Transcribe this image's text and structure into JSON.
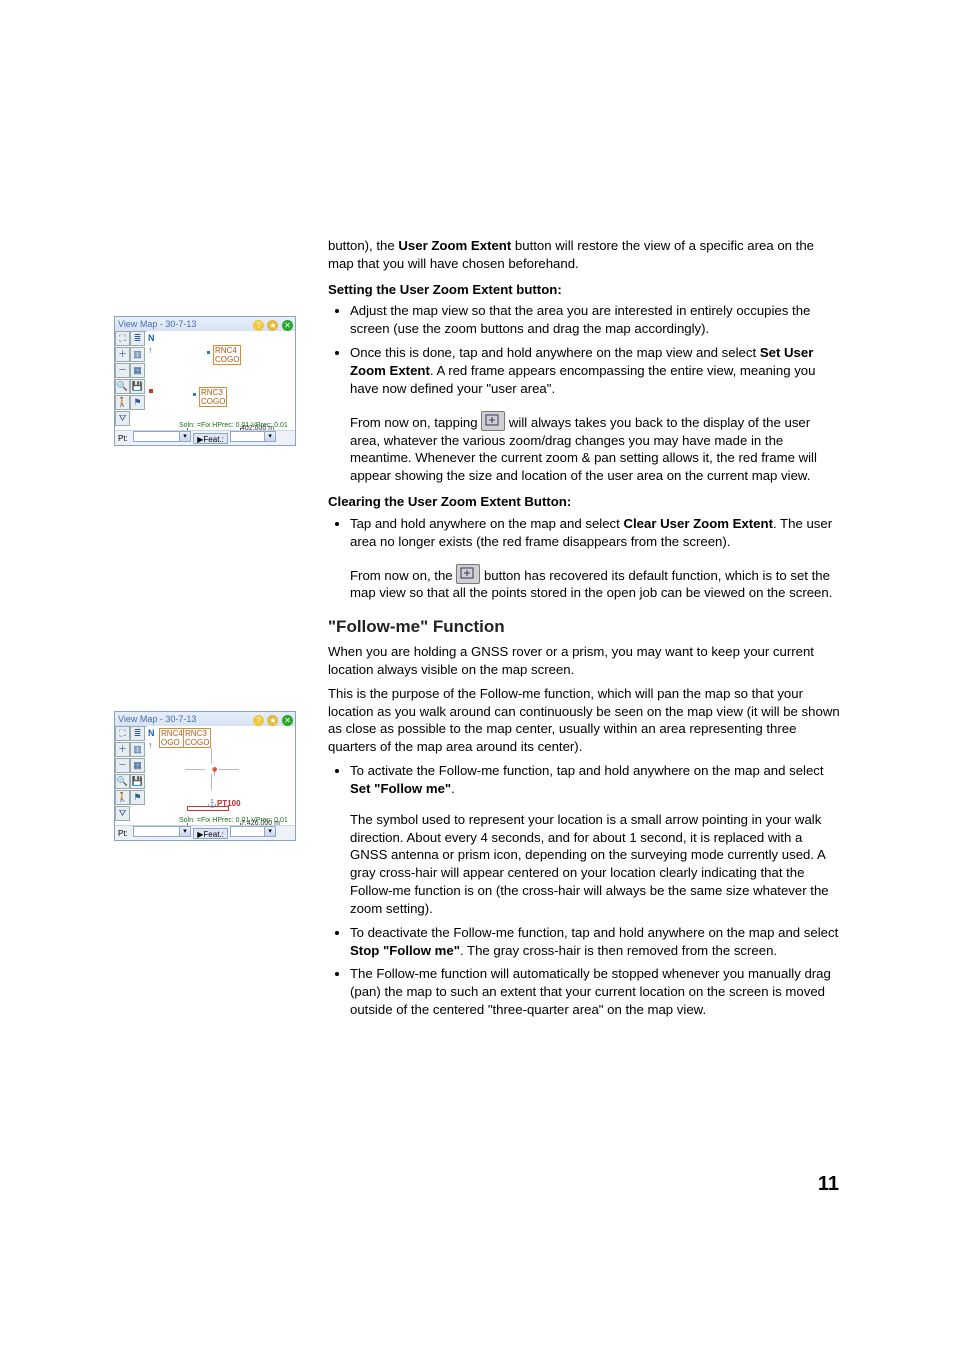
{
  "page_number": "11",
  "intro": {
    "p1_a": "button), the ",
    "p1_b": "User Zoom Extent",
    "p1_c": " button will restore the view of a specific area on the map that you will have chosen beforehand."
  },
  "setting": {
    "hdr": "Setting the User Zoom Extent button",
    "hdr_colon": ":",
    "b1": "Adjust the map view so that the area you are interested in entirely occupies the screen (use the zoom buttons and drag the map accordingly).",
    "b2_a": "Once this is done, tap and hold anywhere on the map view and select ",
    "b2_b": "Set User Zoom Extent",
    "b2_c": ". A red frame appears encompassing the entire view, meaning you have now defined your \"user area\".",
    "after1_a": "From now on, tapping ",
    "after1_b": " will always takes you back to the display of the user area, whatever the various zoom/drag changes you may have made in the meantime. Whenever the current zoom & pan setting allows it, the red frame will appear showing the size and location of the user area on the current map view."
  },
  "clearing": {
    "hdr": "Clearing the User Zoom Extent Button",
    "hdr_colon": ":",
    "b1_a": "Tap and hold anywhere on the map and select ",
    "b1_b": "Clear User Zoom Extent",
    "b1_c": ". The user area no longer exists (the red frame disappears from the screen).",
    "after1_a": "From now on, the ",
    "after1_b": " button has recovered its default function, which is to set the map view so that all the points stored in the open job can be viewed on the screen."
  },
  "follow": {
    "hdr": "\"Follow-me\" Function",
    "p1": "When you are holding a GNSS rover or a prism, you may want to keep your current location always visible on the map screen.",
    "p2": "This is the purpose of the Follow-me function, which will pan the map so that your location as you walk around can continuously be seen on the map view (it will be shown as close as possible to the map center, usually within an area representing three quarters of the map area around its center).",
    "b1_a": "To activate the Follow-me function, tap and hold anywhere on the map and select ",
    "b1_b": "Set \"Follow me\"",
    "b1_c": ".",
    "after1": "The symbol used to represent your location is a small arrow pointing in your walk direction. About every 4 seconds, and for about 1 second, it is replaced with a GNSS antenna or prism icon, depending on the surveying mode currently used. A gray cross-hair will appear centered on your location clearly indicating that the Follow-me function is on (the cross-hair will always be the same size whatever the zoom setting).",
    "b2_a": "To deactivate the Follow-me function, tap and hold anywhere on the map and select ",
    "b2_b": "Stop \"Follow me\"",
    "b2_c": ". The gray cross-hair is then removed from the screen.",
    "b3": "The Follow-me function will automatically be stopped whenever you manually drag (pan) the map to such an extent that your current location on the screen is moved outside of the centered \"three-quarter area\" on the map view."
  },
  "shot1": {
    "title": "View Map - 30-7-13",
    "labels": {
      "a": "RNC4",
      "b": "COGO",
      "c": "RNC3",
      "d": "COGO"
    },
    "status": "Soln: =Fix HPrec: 0.01 VPrec: 0.01",
    "scale": "402.000 m",
    "pt": "Pt:",
    "feat": "▶Feat.:"
  },
  "shot2": {
    "title": "View Map - 30-7-13",
    "labels": {
      "a": "RNC4",
      "b": "OGO",
      "c": "RNC3",
      "d": "COGO"
    },
    "anchor": "PT100",
    "status": "Soln: =Fix HPrec: 0.01 VPrec: 0.01",
    "scale": "7,426.000 m",
    "pt": "Pt:",
    "feat": "▶Feat.:"
  }
}
